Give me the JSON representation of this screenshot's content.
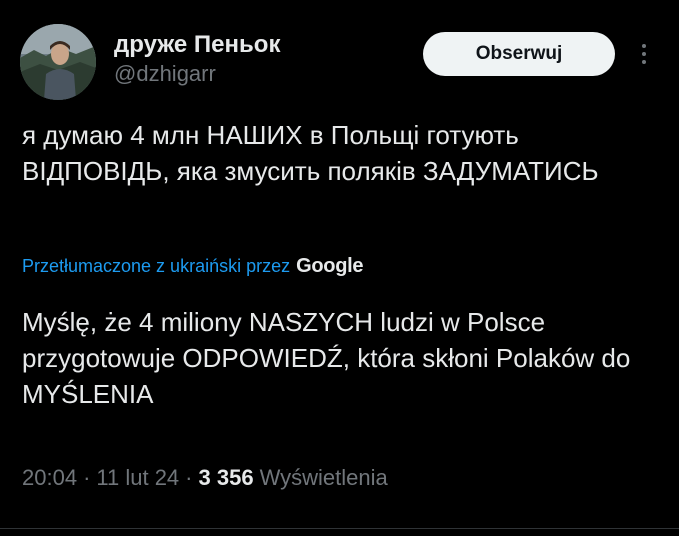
{
  "author": {
    "display_name": "друже Пеньок",
    "handle": "@dzhigarr"
  },
  "follow_button": {
    "label": "Obserwuj"
  },
  "more_button": {
    "icon": "more-vertical-icon"
  },
  "tweet": {
    "original_text": "я думаю 4 млн НАШИХ в Польщі готують ВІДПОВІДЬ, яка змусить поляків ЗАДУМАТИСЬ",
    "translated_label": "Przetłumaczone z ukraiński przez",
    "translator": "Google",
    "translated_text": "Myślę, że 4 miliony NASZYCH ludzi w Polsce przygotowuje ODPOWIEDŹ, która skłoni Polaków do MYŚLENIA"
  },
  "meta": {
    "time": "20:04",
    "date": "11 lut 24",
    "separator": "·",
    "views_count": "3 356",
    "views_label": "Wyświetlenia"
  },
  "colors": {
    "background": "#000000",
    "text": "#e7e9ea",
    "secondary": "#71767b",
    "link": "#1d9bf0",
    "button_bg": "#eff3f4"
  }
}
